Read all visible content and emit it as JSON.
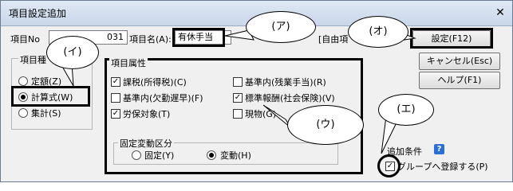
{
  "window": {
    "title": "項目設定追加",
    "close_glyph": "✕"
  },
  "fields": {
    "item_no_label": "項目No",
    "item_no_value": "031",
    "item_name_label": "項目名(A):",
    "item_name_value": "有休手当",
    "print_name_label": "[自由項"
  },
  "item_type": {
    "title": "項目種",
    "options": [
      "定額(Z)",
      "計算式(W)",
      "集計(S)"
    ],
    "selected": "計算式(W)"
  },
  "attributes": {
    "title": "項目属性",
    "checkboxes": [
      {
        "label": "課税(所得税)(C)",
        "checked": true
      },
      {
        "label": "基準内(残業手当)(R)",
        "checked": false
      },
      {
        "label": "基準内(欠勤遅早)(F)",
        "checked": false
      },
      {
        "label": "標準報酬(社会保険)(V)",
        "checked": true
      },
      {
        "label": "労保対象(T)",
        "checked": true
      },
      {
        "label": "現物(G)",
        "checked": false
      }
    ],
    "fixed_change": {
      "title": "固定変動区分",
      "options": [
        "固定(Y)",
        "変動(H)"
      ],
      "selected": "変動(H)"
    }
  },
  "buttons": {
    "settings": "設定(F12)",
    "cancel": "キャンセル(Esc)",
    "help": "ヘルプ(F1)"
  },
  "add_condition": {
    "label": "追加条件",
    "help_glyph": "?",
    "checkbox_label": "グループへ登録する(P)",
    "checked": true
  },
  "callouts": [
    "(ア)",
    "(イ)",
    "(ウ)",
    "(エ)",
    "(オ)"
  ]
}
